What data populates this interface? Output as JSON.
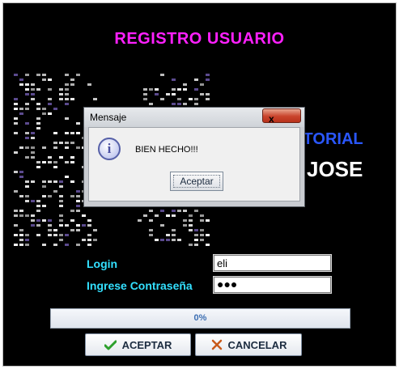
{
  "form": {
    "title": "REGISTRO USUARIO",
    "brand_line1": "ITORIAL",
    "brand_line2": "JOSE",
    "login_label": "Login",
    "login_value": "eli",
    "password_label": "Ingrese Contraseña",
    "password_value": "●●●",
    "progress": {
      "text": "0%",
      "value": 0
    },
    "accept_label": "ACEPTAR",
    "cancel_label": "CANCELAR",
    "accept_icon": "checkmark-icon",
    "cancel_icon": "x-mark-icon"
  },
  "dialog": {
    "title": "Mensaje",
    "close_glyph": "x",
    "icon": "information-icon",
    "icon_glyph": "i",
    "message": "BIEN HECHO!!!",
    "ok_label": "Aceptar"
  },
  "colors": {
    "background": "#000000",
    "title": "#ff20ff",
    "labels": "#33e0ff",
    "brand": "#2a57ff"
  }
}
